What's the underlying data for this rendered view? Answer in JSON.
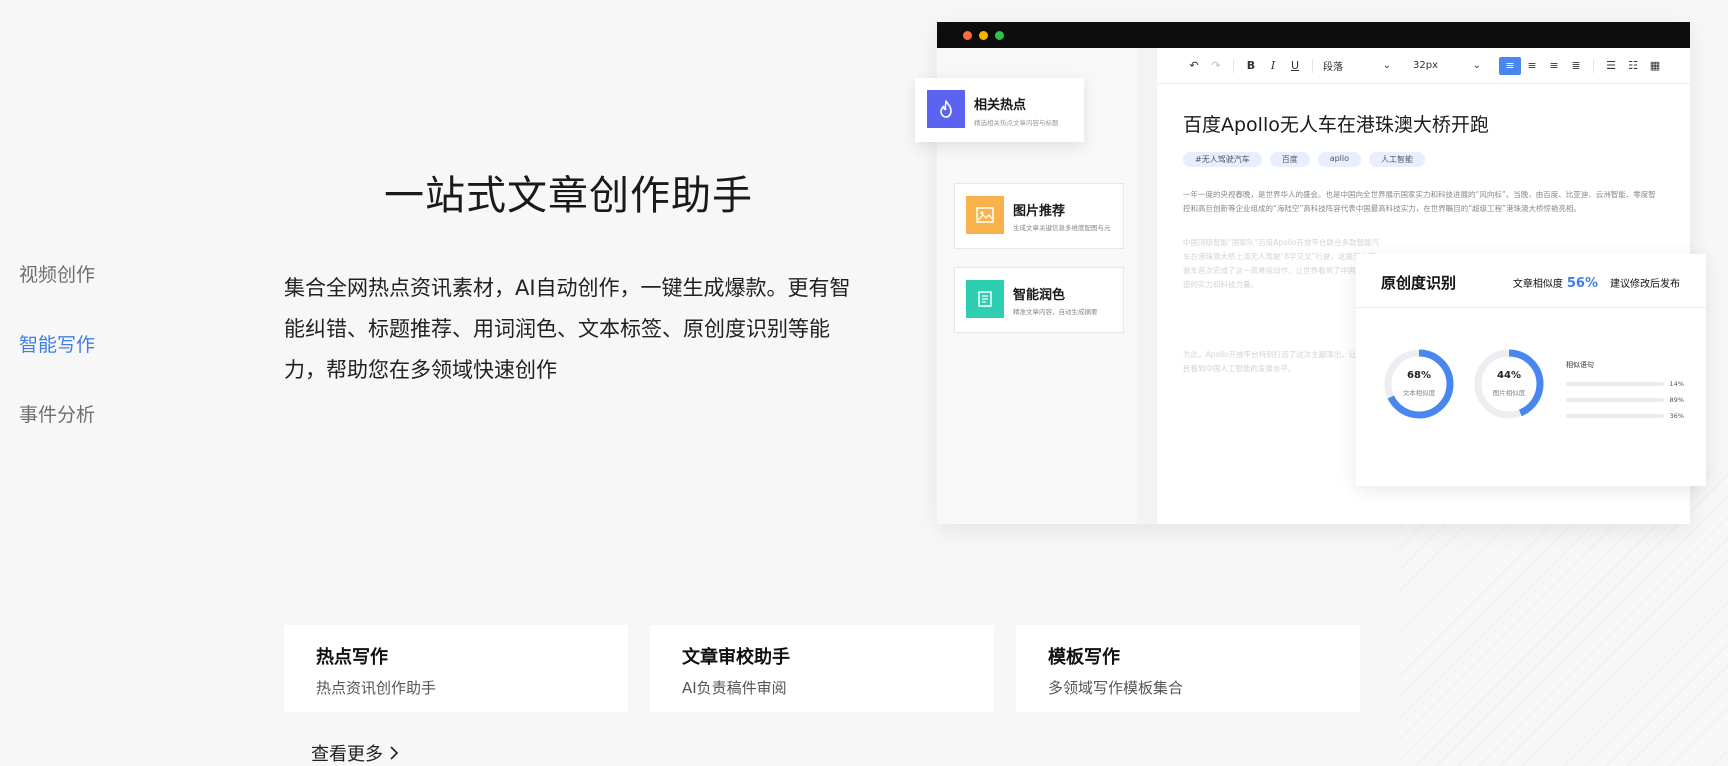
{
  "side_nav": {
    "items": [
      {
        "label": "视频创作"
      },
      {
        "label": "智能写作"
      },
      {
        "label": "事件分析"
      }
    ],
    "active_index": 1
  },
  "hero": {
    "title": "一站式文章创作助手",
    "description": "集合全网热点资讯素材，AI自动创作，一键生成爆款。更有智能纠错、标题推荐、用词润色、文本标签、原创度识别等能力，帮助您在多领域快速创作"
  },
  "mock": {
    "window_dots": [
      "#ff6b3d",
      "#f5b400",
      "#2bc24d"
    ],
    "toolbar": {
      "bold": "B",
      "italic": "I",
      "underline": "U",
      "paragraph_select": "段落",
      "size_select": "32px"
    },
    "article": {
      "title": "百度Apollo无人车在港珠澳大桥开跑",
      "tags": [
        "#无人驾驶汽车",
        "百度",
        "apllo",
        "人工智能"
      ],
      "para1": "一年一度的央视春晚，是世界华人的盛会。也是中国向全世界展示国家实力和科技进展的“风向标”。当晚，由百度、比亚迪、云洲智能、零度智控和高巨创新等企业组成的“海陆空”高科技阵容代表中国最高科技实力，在世界瞩目的“超级工程”港珠澳大桥惊艳亮相。",
      "para2": "中国顶级智能“国家队”百度Apollo开放平台联合多款智能汽车在港珠澳大桥上演无人驾驶“8字交叉”行驶，这是无人驾驶车首次完成了这一高难度动作，让世界看到了中国智能制造的实力和科技力量。",
      "para3": "为此，Apollo开放平台特别打造了这次主题演出，让全球人民看到中国人工智能的发展水平。"
    },
    "hot_card": {
      "title": "相关热点",
      "subtitle": "精选相关热点文章内容与标题"
    },
    "image_card": {
      "title": "图片推荐",
      "subtitle": "生成文章关键信息多维度配图与元"
    },
    "polish_card": {
      "title": "智能润色",
      "subtitle": "精准文章内容，自动生成摘要"
    }
  },
  "originality": {
    "title": "原创度识别",
    "similarity_label": "文章相似度",
    "similarity_value": "56%",
    "action": "建议修改后发布",
    "donuts": [
      {
        "value": "68%",
        "label": "文本相似度",
        "fraction": 0.68
      },
      {
        "value": "44%",
        "label": "图片相似度",
        "fraction": 0.44
      }
    ],
    "similar_header": "相似语句",
    "similar_rows": [
      "14%",
      "89%",
      "36%"
    ],
    "accent": "#4a86f0"
  },
  "features": [
    {
      "title": "热点写作",
      "subtitle": "热点资讯创作助手"
    },
    {
      "title": "文章审校助手",
      "subtitle": "AI负责稿件审阅"
    },
    {
      "title": "模板写作",
      "subtitle": "多领域写作模板集合"
    }
  ],
  "more_link": "查看更多"
}
